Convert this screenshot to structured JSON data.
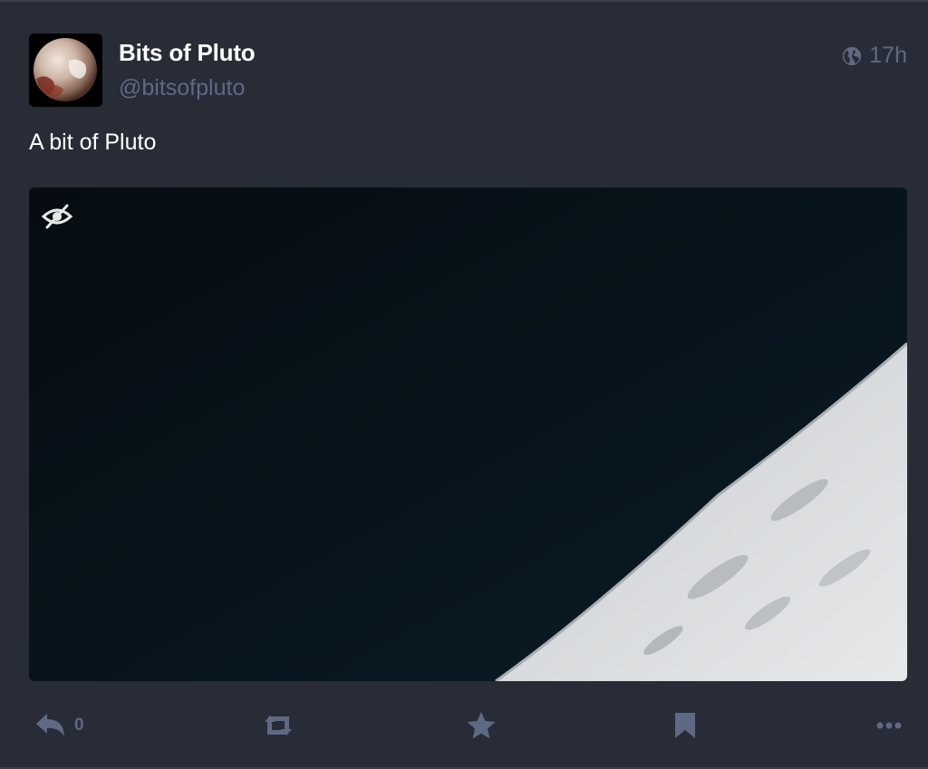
{
  "status": {
    "account": {
      "display_name": "Bits of Pluto",
      "handle": "@bitsofpluto",
      "avatar_icon": "pluto-avatar"
    },
    "visibility_icon": "globe-icon",
    "timestamp": "17h",
    "content": "A bit of Pluto",
    "media": {
      "type": "image",
      "hide_icon": "eye-slash-icon"
    },
    "actions": {
      "reply_count": "0",
      "reply_icon": "reply-icon",
      "boost_icon": "retweet-icon",
      "favourite_icon": "star-icon",
      "bookmark_icon": "bookmark-icon",
      "more_icon": "ellipsis-icon"
    },
    "colors": {
      "background": "#282c37",
      "muted": "#606984",
      "text": "#ffffff",
      "border": "#393f4f"
    }
  }
}
